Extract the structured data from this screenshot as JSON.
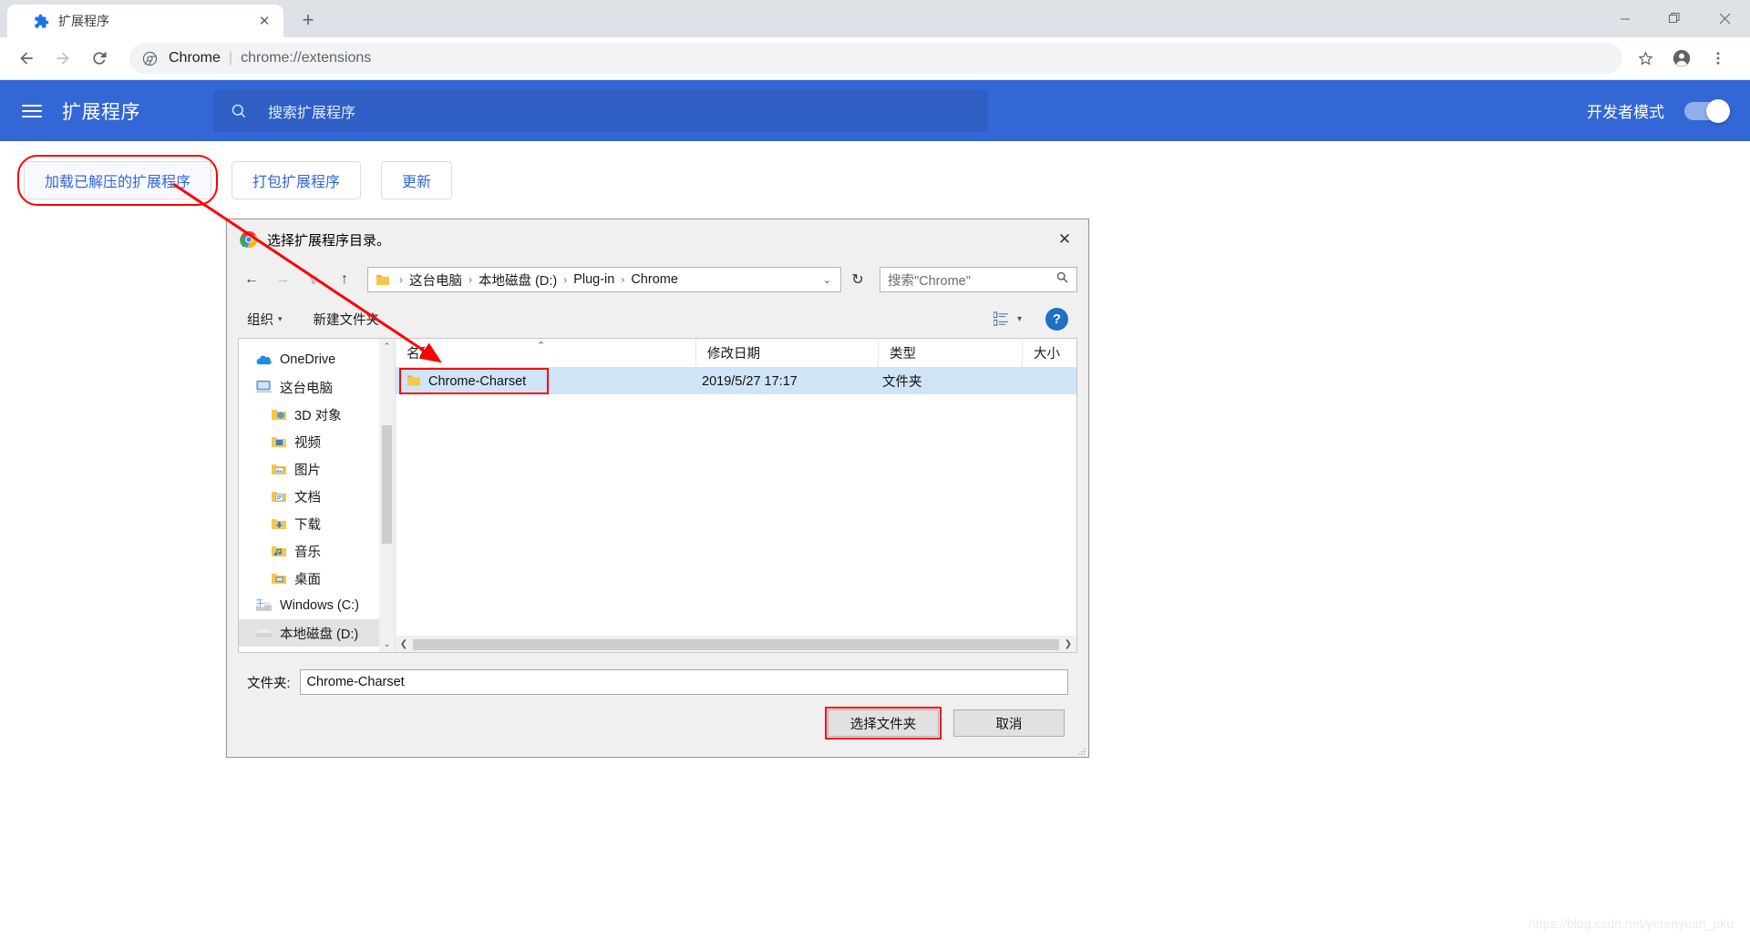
{
  "browser": {
    "tab": {
      "title": "扩展程序",
      "favicon": "puzzle-icon",
      "close": "✕"
    },
    "newtab_label": "+",
    "window_controls": {
      "minimize": "—",
      "restore": "❐",
      "close": "✕"
    },
    "nav": {
      "back": "←",
      "forward": "→",
      "reload": "⟳"
    },
    "omnibox": {
      "scheme_label": "Chrome",
      "separator": "|",
      "url": "chrome://extensions",
      "star": "☆"
    },
    "profile_icon": "account-icon",
    "menu_icon": "three-dot-menu-icon"
  },
  "extensions_page": {
    "title": "扩展程序",
    "search_placeholder": "搜索扩展程序",
    "devmode_label": "开发者模式",
    "devmode_on": true,
    "accent_color": "#3367d6",
    "buttons": [
      {
        "label": "加载已解压的扩展程序",
        "highlighted": true
      },
      {
        "label": "打包扩展程序",
        "highlighted": false
      },
      {
        "label": "更新",
        "highlighted": false
      }
    ]
  },
  "dialog": {
    "title": "选择扩展程序目录。",
    "close_label": "✕",
    "nav": {
      "back": "←",
      "forward": "→",
      "recent": "∨",
      "up": "↑",
      "refresh": "↻"
    },
    "breadcrumb": [
      "这台电脑",
      "本地磁盘 (D:)",
      "Plug-in",
      "Chrome"
    ],
    "breadcrumb_caret": "⌄",
    "search_placeholder": "搜索\"Chrome\"",
    "toolbar": {
      "organize": "组织",
      "organize_caret": "▾",
      "new_folder": "新建文件夹",
      "view_caret": "▾",
      "help": "?"
    },
    "sidebar": [
      {
        "label": "OneDrive",
        "icon": "onedrive-icon",
        "indent": false,
        "selected": false
      },
      {
        "label": "这台电脑",
        "icon": "this-pc-icon",
        "indent": false,
        "selected": false
      },
      {
        "label": "3D 对象",
        "icon": "folder-3d-icon",
        "indent": true,
        "selected": false
      },
      {
        "label": "视频",
        "icon": "folder-video-icon",
        "indent": true,
        "selected": false
      },
      {
        "label": "图片",
        "icon": "folder-pictures-icon",
        "indent": true,
        "selected": false
      },
      {
        "label": "文档",
        "icon": "folder-documents-icon",
        "indent": true,
        "selected": false
      },
      {
        "label": "下载",
        "icon": "folder-downloads-icon",
        "indent": true,
        "selected": false
      },
      {
        "label": "音乐",
        "icon": "folder-music-icon",
        "indent": true,
        "selected": false
      },
      {
        "label": "桌面",
        "icon": "folder-desktop-icon",
        "indent": true,
        "selected": false
      },
      {
        "label": "Windows (C:)",
        "icon": "drive-windows-icon",
        "indent": false,
        "selected": false
      },
      {
        "label": "本地磁盘 (D:)",
        "icon": "drive-local-icon",
        "indent": false,
        "selected": true
      }
    ],
    "columns": [
      "名称",
      "修改日期",
      "类型",
      "大小"
    ],
    "rows": [
      {
        "name": "Chrome-Charset",
        "date": "2019/5/27 17:17",
        "type": "文件夹",
        "size": "",
        "selected": true,
        "highlighted": true
      }
    ],
    "footer": {
      "folder_label": "文件夹:",
      "folder_value": "Chrome-Charset",
      "select_button": "选择文件夹",
      "cancel_button": "取消"
    }
  },
  "watermark": "https://blog.csdn.net/yerenyuan_pku"
}
